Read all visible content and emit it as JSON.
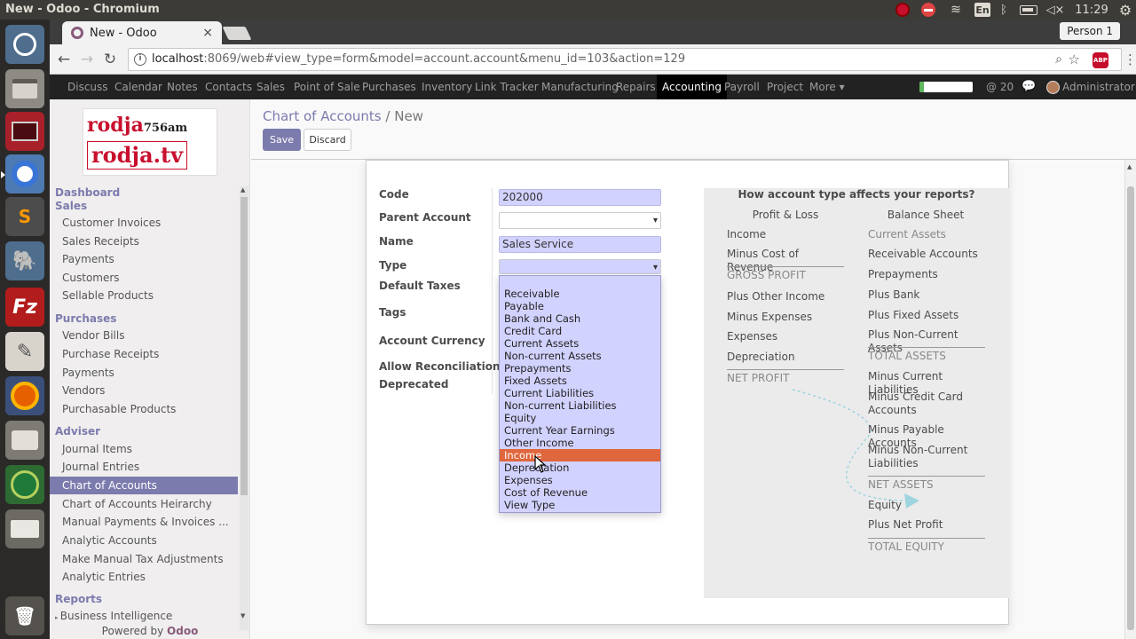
{
  "os": {
    "window_title": "New - Odoo - Chromium",
    "lang": "En",
    "time": "11:29"
  },
  "browser": {
    "tab_title": "New - Odoo",
    "tab_close": "×",
    "person": "Person 1",
    "url_host": "localhost",
    "url_rest": ":8069/web#view_type=form&model=account.account&menu_id=103&action=129",
    "abp_label": "ABP"
  },
  "odoo_menu": {
    "items": [
      "Discuss",
      "Calendar",
      "Notes",
      "Contacts",
      "Sales",
      "Point of Sale",
      "Purchases",
      "Inventory",
      "Link Tracker",
      "Manufacturing",
      "Repairs",
      "Accounting",
      "Payroll",
      "Project",
      "More ▾"
    ],
    "active": "Accounting",
    "message_count": "@ 20",
    "user": "Administrator ▾",
    "progress": 0.08,
    "progress_color": "#5cb85c"
  },
  "logo": {
    "line1": "rodja",
    "line1_small": "756am",
    "line2": "rodja.tv"
  },
  "sidebar": {
    "dashboard": "Dashboard",
    "sales_head": "Sales",
    "sales_items": [
      "Customer Invoices",
      "Sales Receipts",
      "Payments",
      "Customers",
      "Sellable Products"
    ],
    "purchases_head": "Purchases",
    "purchases_items": [
      "Vendor Bills",
      "Purchase Receipts",
      "Payments",
      "Vendors",
      "Purchasable Products"
    ],
    "adviser_head": "Adviser",
    "adviser_items": [
      "Journal Items",
      "Journal Entries",
      "Chart of Accounts",
      "Chart of Accounts Heirarchy",
      "Manual Payments & Invoices ...",
      "Analytic Accounts",
      "Make Manual Tax Adjustments",
      "Analytic Entries"
    ],
    "active_item": "Chart of Accounts",
    "reports_head": "Reports",
    "reports_item": "Business Intelligence",
    "powered_prefix": "Powered by",
    "powered_brand": "Odoo"
  },
  "control_panel": {
    "breadcrumb_parent": "Chart of Accounts",
    "breadcrumb_sep": "/",
    "breadcrumb_current": "New",
    "save_label": "Save",
    "discard_label": "Discard"
  },
  "form": {
    "labels": {
      "code": "Code",
      "parent_account": "Parent Account",
      "name": "Name",
      "type": "Type",
      "default_taxes": "Default Taxes",
      "tags": "Tags",
      "account_currency": "Account Currency",
      "allow_reconciliation": "Allow Reconciliation",
      "deprecated": "Deprecated"
    },
    "values": {
      "code": "202000",
      "parent_account": "",
      "name": "Sales Service",
      "type": ""
    },
    "type_options": [
      "Receivable",
      "Payable",
      "Bank and Cash",
      "Credit Card",
      "Current Assets",
      "Non-current Assets",
      "Prepayments",
      "Fixed Assets",
      "Current Liabilities",
      "Non-current Liabilities",
      "Equity",
      "Current Year Earnings",
      "Other Income",
      "Income",
      "Depreciation",
      "Expenses",
      "Cost of Revenue",
      "View Type"
    ],
    "type_highlighted": "Income"
  },
  "help": {
    "title": "How account type affects your reports?",
    "pl_head": "Profit & Loss",
    "bs_head": "Balance Sheet",
    "pl_rows": [
      {
        "text": "Income",
        "kind": "normal"
      },
      {
        "text": "Minus Cost of Revenue",
        "kind": "normal"
      },
      {
        "text": "GROSS PROFIT",
        "kind": "total"
      },
      {
        "text": "Plus Other Income",
        "kind": "normal"
      },
      {
        "text": "Minus Expenses",
        "kind": "normal"
      },
      {
        "text": "Expenses",
        "kind": "normal"
      },
      {
        "text": "Depreciation",
        "kind": "normal"
      },
      {
        "text": "NET PROFIT",
        "kind": "total"
      }
    ],
    "bs_rows": [
      {
        "text": "Current Assets",
        "kind": "sub"
      },
      {
        "text": "Receivable Accounts",
        "kind": "normal"
      },
      {
        "text": "Prepayments",
        "kind": "normal"
      },
      {
        "text": "Plus Bank",
        "kind": "normal"
      },
      {
        "text": "Plus Fixed Assets",
        "kind": "normal"
      },
      {
        "text": "Plus Non-Current Assets",
        "kind": "normal"
      },
      {
        "text": "TOTAL ASSETS",
        "kind": "total"
      },
      {
        "text": "Minus Current Liabilities",
        "kind": "normal"
      },
      {
        "text": "Minus Credit Card Accounts",
        "kind": "normal"
      },
      {
        "text": "Minus Payable Accounts",
        "kind": "normal"
      },
      {
        "text": "Minus Non-Current Liabilities",
        "kind": "normal"
      },
      {
        "text": "NET ASSETS",
        "kind": "total"
      },
      {
        "text": "Equity",
        "kind": "normal"
      },
      {
        "text": "Plus Net Profit",
        "kind": "normal"
      },
      {
        "text": "TOTAL EQUITY",
        "kind": "total"
      }
    ]
  },
  "colors": {
    "brand": "#7c7bad",
    "odoo": "#875a7b",
    "highlight": "#e0663e",
    "flow_arrow": "#9fd5df"
  }
}
